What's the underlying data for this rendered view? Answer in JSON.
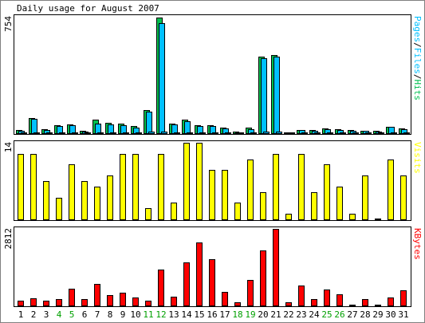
{
  "chart_data": [
    {
      "type": "bar",
      "title": "Daily usage for August 2007",
      "max_label": "754",
      "legend": [
        {
          "text": "Pages",
          "color": "#00c0ff"
        },
        {
          "text": "Files",
          "color": "#00c0ff"
        },
        {
          "text": "Hits",
          "color": "#00c050"
        }
      ],
      "legend_separator_color": "#000000",
      "ylim": [
        0,
        754
      ],
      "categories": [
        "1",
        "2",
        "3",
        "4",
        "5",
        "6",
        "7",
        "8",
        "9",
        "10",
        "11",
        "12",
        "13",
        "14",
        "15",
        "16",
        "17",
        "18",
        "19",
        "20",
        "21",
        "22",
        "23",
        "24",
        "25",
        "26",
        "27",
        "28",
        "29",
        "30",
        "31"
      ],
      "series": [
        {
          "name": "Hits",
          "color": "#00c050",
          "values": [
            20,
            98,
            26,
            52,
            56,
            16,
            90,
            70,
            64,
            46,
            150,
            754,
            62,
            88,
            54,
            52,
            36,
            8,
            38,
            500,
            508,
            4,
            22,
            22,
            30,
            28,
            22,
            18,
            14,
            44,
            30
          ]
        },
        {
          "name": "Files",
          "color": "#00c0ff",
          "values": [
            16,
            92,
            22,
            46,
            52,
            12,
            64,
            56,
            54,
            36,
            138,
            718,
            56,
            76,
            48,
            46,
            30,
            6,
            24,
            490,
            498,
            3,
            20,
            18,
            26,
            22,
            18,
            14,
            12,
            40,
            26
          ]
        },
        {
          "name": "Pages",
          "color": "#00c0ff",
          "values": [
            4,
            4,
            4,
            6,
            6,
            3,
            6,
            5,
            5,
            4,
            8,
            10,
            6,
            7,
            5,
            5,
            4,
            2,
            4,
            8,
            8,
            1,
            3,
            3,
            3,
            3,
            2,
            2,
            2,
            4,
            3
          ]
        }
      ]
    },
    {
      "type": "bar",
      "max_label": "14",
      "legend": [
        {
          "text": "Visits",
          "color": "#ffff00"
        }
      ],
      "ylim": [
        0,
        14
      ],
      "categories": [
        "1",
        "2",
        "3",
        "4",
        "5",
        "6",
        "7",
        "8",
        "9",
        "10",
        "11",
        "12",
        "13",
        "14",
        "15",
        "16",
        "17",
        "18",
        "19",
        "20",
        "21",
        "22",
        "23",
        "24",
        "25",
        "26",
        "27",
        "28",
        "29",
        "30",
        "31"
      ],
      "series": [
        {
          "name": "Visits",
          "color": "#ffff00",
          "values": [
            12,
            12,
            7,
            4,
            10,
            7,
            6,
            8,
            12,
            12,
            2,
            12,
            3,
            14,
            14,
            9,
            9,
            3,
            11,
            5,
            12,
            1,
            12,
            5,
            10,
            6,
            1,
            8,
            0,
            11,
            8
          ]
        }
      ]
    },
    {
      "type": "bar",
      "max_label": "2812",
      "legend": [
        {
          "text": "KBytes",
          "color": "#ff0000"
        }
      ],
      "ylim": [
        0,
        2812
      ],
      "categories": [
        "1",
        "2",
        "3",
        "4",
        "5",
        "6",
        "7",
        "8",
        "9",
        "10",
        "11",
        "12",
        "13",
        "14",
        "15",
        "16",
        "17",
        "18",
        "19",
        "20",
        "21",
        "22",
        "23",
        "24",
        "25",
        "26",
        "27",
        "28",
        "29",
        "30",
        "31"
      ],
      "series": [
        {
          "name": "KBytes",
          "color": "#ff0000",
          "values": [
            180,
            260,
            180,
            240,
            620,
            240,
            780,
            380,
            460,
            280,
            180,
            1320,
            320,
            1590,
            2300,
            1710,
            500,
            110,
            950,
            2030,
            2812,
            120,
            720,
            230,
            600,
            420,
            30,
            240,
            40,
            280,
            550
          ]
        }
      ]
    }
  ],
  "x_labels": [
    {
      "text": "1",
      "color": "#000000"
    },
    {
      "text": "2",
      "color": "#000000"
    },
    {
      "text": "3",
      "color": "#000000"
    },
    {
      "text": "4",
      "color": "#00a000"
    },
    {
      "text": "5",
      "color": "#00a000"
    },
    {
      "text": "6",
      "color": "#000000"
    },
    {
      "text": "7",
      "color": "#000000"
    },
    {
      "text": "8",
      "color": "#000000"
    },
    {
      "text": "9",
      "color": "#000000"
    },
    {
      "text": "10",
      "color": "#000000"
    },
    {
      "text": "11",
      "color": "#00a000"
    },
    {
      "text": "12",
      "color": "#00a000"
    },
    {
      "text": "13",
      "color": "#000000"
    },
    {
      "text": "14",
      "color": "#000000"
    },
    {
      "text": "15",
      "color": "#000000"
    },
    {
      "text": "16",
      "color": "#000000"
    },
    {
      "text": "17",
      "color": "#000000"
    },
    {
      "text": "18",
      "color": "#00a000"
    },
    {
      "text": "19",
      "color": "#00a000"
    },
    {
      "text": "20",
      "color": "#000000"
    },
    {
      "text": "21",
      "color": "#000000"
    },
    {
      "text": "22",
      "color": "#000000"
    },
    {
      "text": "23",
      "color": "#000000"
    },
    {
      "text": "24",
      "color": "#000000"
    },
    {
      "text": "25",
      "color": "#00a000"
    },
    {
      "text": "26",
      "color": "#00a000"
    },
    {
      "text": "27",
      "color": "#000000"
    },
    {
      "text": "28",
      "color": "#000000"
    },
    {
      "text": "29",
      "color": "#000000"
    },
    {
      "text": "30",
      "color": "#000000"
    },
    {
      "text": "31",
      "color": "#000000"
    }
  ],
  "colors": {
    "background": "#ffffff",
    "panel": "#ffffff",
    "border": "#000000",
    "page_border": "#808080"
  }
}
